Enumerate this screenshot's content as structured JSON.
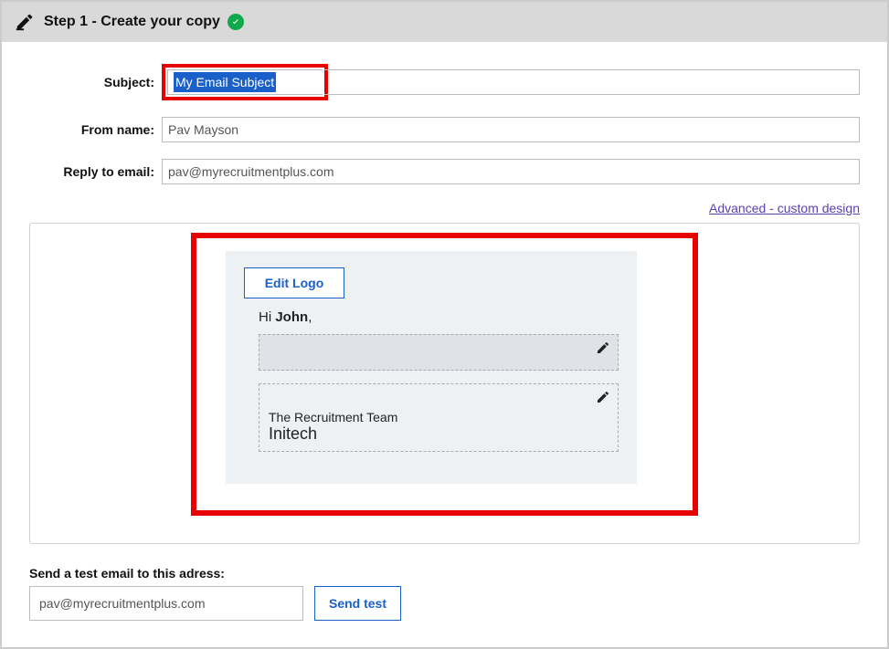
{
  "header": {
    "title": "Step 1 - Create your copy"
  },
  "fields": {
    "subject_label": "Subject:",
    "subject_value": "My Email Subject",
    "from_label": "From name:",
    "from_value": "Pav Mayson",
    "reply_label": "Reply to email:",
    "reply_value": "pav@myrecruitmentplus.com"
  },
  "advanced_link": "Advanced - custom design",
  "preview": {
    "edit_logo": "Edit Logo",
    "greeting_prefix": "Hi ",
    "greeting_name": "John",
    "sig_line1": "The Recruitment Team",
    "sig_line2": "Initech"
  },
  "test": {
    "label": "Send a test email to this adress:",
    "email": "pav@myrecruitmentplus.com",
    "button": "Send test"
  }
}
